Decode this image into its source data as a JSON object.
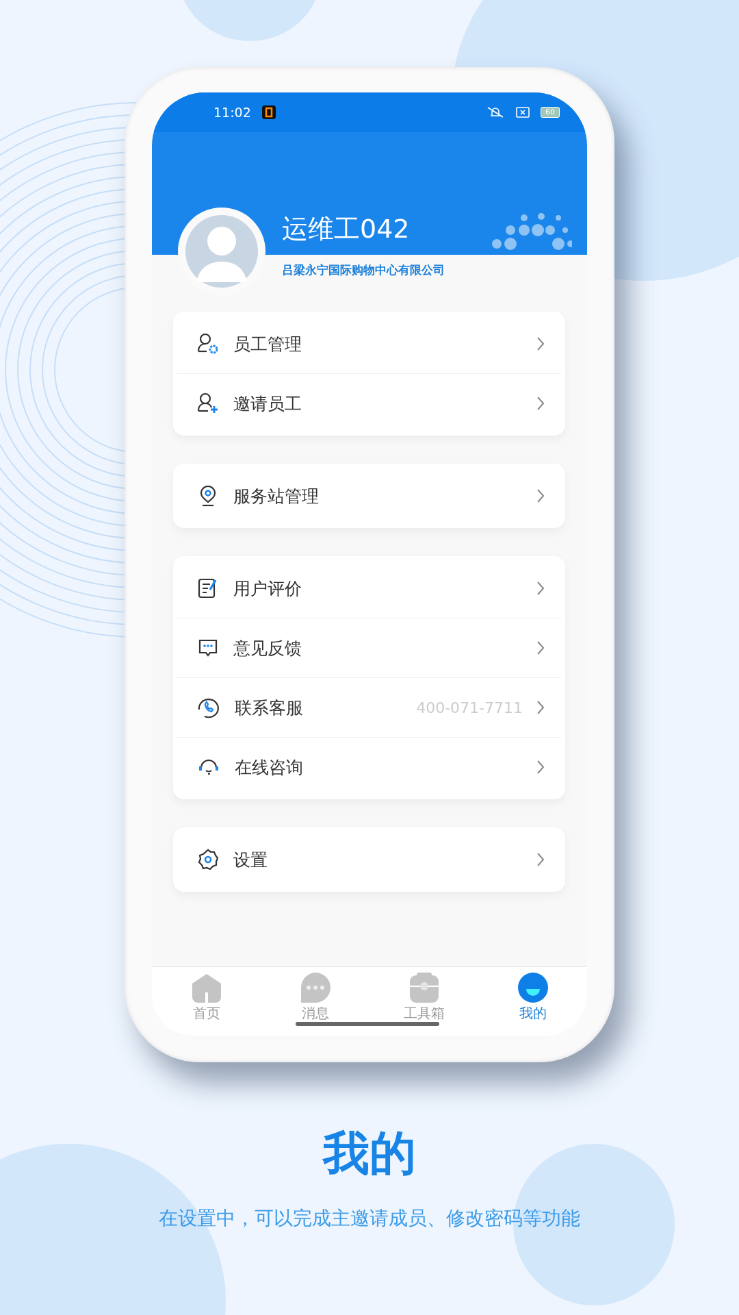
{
  "status_bar": {
    "time": "11:02",
    "battery": "60"
  },
  "profile": {
    "name": "运维工042",
    "company": "吕梁永宁国际购物中心有限公司"
  },
  "menu_groups": [
    {
      "items": [
        {
          "label": "员工管理"
        },
        {
          "label": "邀请员工"
        }
      ]
    },
    {
      "items": [
        {
          "label": "服务站管理"
        }
      ]
    },
    {
      "items": [
        {
          "label": "用户评价"
        },
        {
          "label": "意见反馈"
        },
        {
          "label": "联系客服",
          "value": "400-071-7711"
        },
        {
          "label": "在线咨询"
        }
      ]
    },
    {
      "items": [
        {
          "label": "设置"
        }
      ]
    }
  ],
  "tab_bar": [
    {
      "label": "首页",
      "selected": false
    },
    {
      "label": "消息",
      "selected": false
    },
    {
      "label": "工具箱",
      "selected": false
    },
    {
      "label": "我的",
      "selected": true
    }
  ],
  "caption": {
    "title": "我的",
    "subtitle": "在设置中，可以完成主邀请成员、修改密码等功能"
  }
}
